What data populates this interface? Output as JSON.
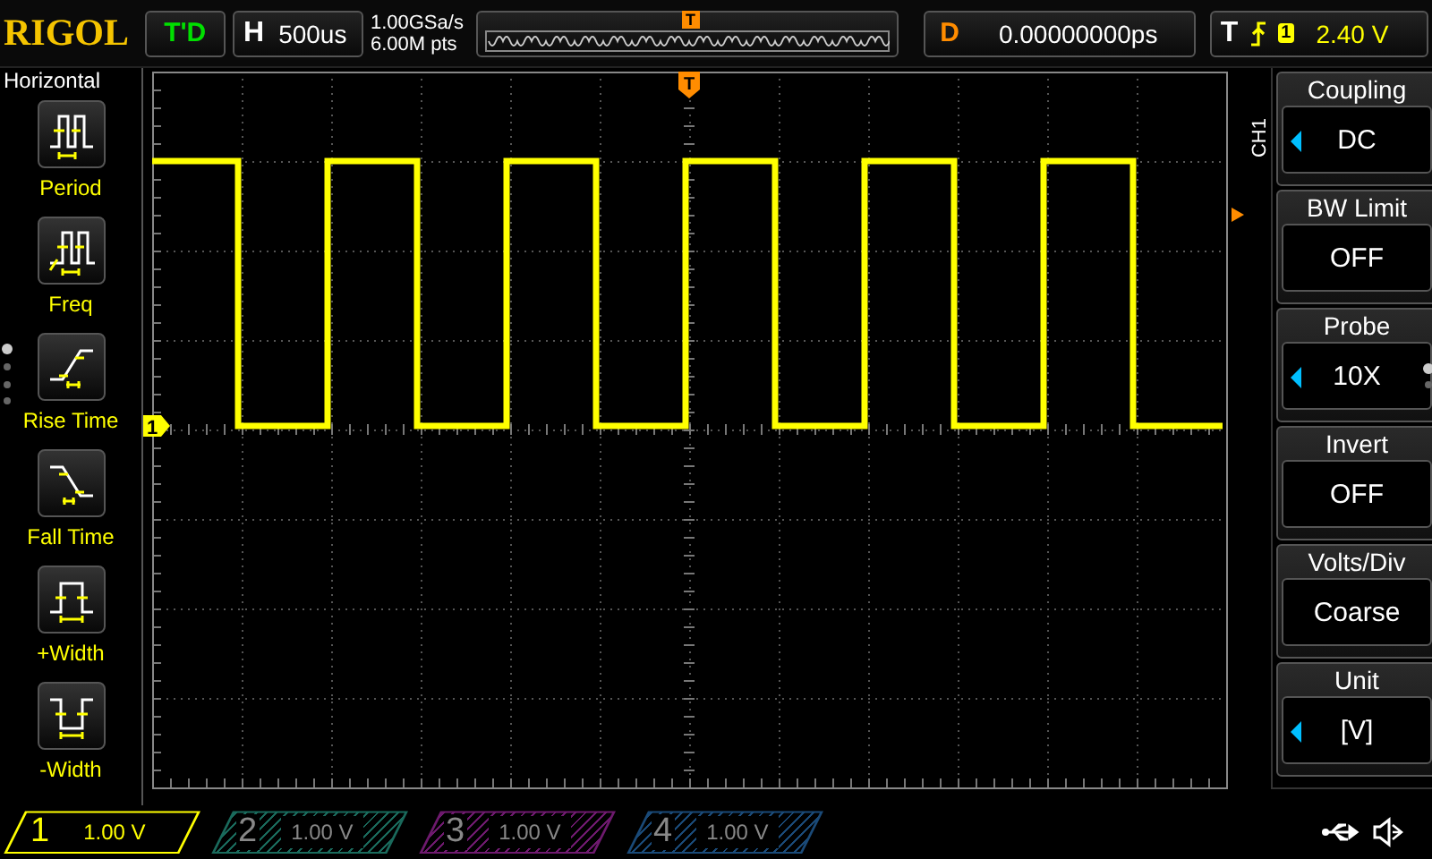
{
  "top_bar": {
    "brand": "RIGOL",
    "run_status": "T'D",
    "horizontal": {
      "label": "H",
      "value": "500us"
    },
    "sample_rate": "1.00GSa/s",
    "memory_depth": "6.00M pts",
    "trigger_position_marker": "T",
    "delay": {
      "label": "D",
      "value": "0.00000000ps"
    },
    "trigger": {
      "label": "T",
      "source": "1",
      "level": "2.40 V"
    }
  },
  "left_menu": {
    "title": "Horizontal",
    "items": [
      {
        "label": "Period",
        "kind": "period"
      },
      {
        "label": "Freq",
        "kind": "freq"
      },
      {
        "label": "Rise Time",
        "kind": "rise"
      },
      {
        "label": "Fall Time",
        "kind": "fall"
      },
      {
        "label": "+Width",
        "kind": "pwidth"
      },
      {
        "label": "-Width",
        "kind": "nwidth"
      }
    ]
  },
  "plot": {
    "channel_marker": "1",
    "trigger_marker": "T"
  },
  "right_menu": {
    "channel": "CH1",
    "items": [
      {
        "title": "Coupling",
        "value": "DC",
        "adjustable": true
      },
      {
        "title": "BW Limit",
        "value": "OFF",
        "adjustable": false
      },
      {
        "title": "Probe",
        "value": "10X",
        "adjustable": true
      },
      {
        "title": "Invert",
        "value": "OFF",
        "adjustable": false
      },
      {
        "title": "Volts/Div",
        "value": "Coarse",
        "adjustable": false
      },
      {
        "title": "Unit",
        "value": "[V]",
        "adjustable": true
      }
    ]
  },
  "channels": [
    {
      "number": "1",
      "value": "1.00 V",
      "color": "#ffff00",
      "selected": true
    },
    {
      "number": "2",
      "value": "1.00 V",
      "color": "#1a6a5c",
      "selected": false
    },
    {
      "number": "3",
      "value": "1.00 V",
      "color": "#6e1a6e",
      "selected": false
    },
    {
      "number": "4",
      "value": "1.00 V",
      "color": "#1a4a78",
      "selected": false
    }
  ]
}
